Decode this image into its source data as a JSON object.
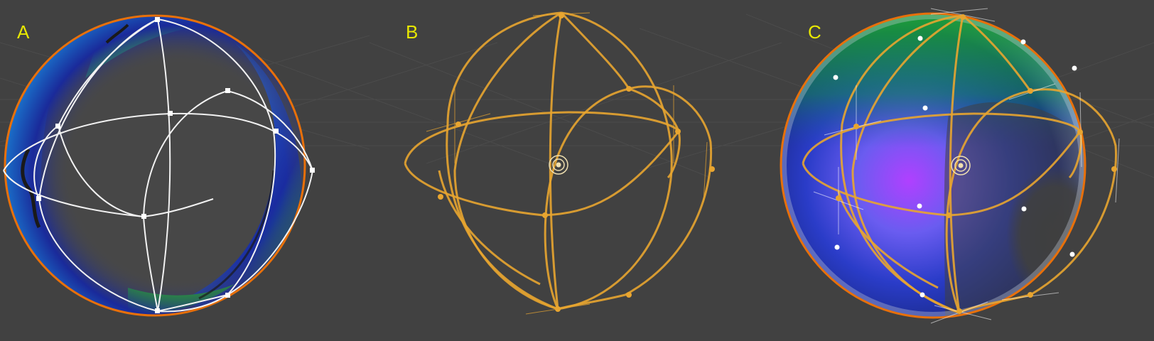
{
  "panels": [
    {
      "label": "A",
      "style": "shaded-white-cage"
    },
    {
      "label": "B",
      "style": "wireframe"
    },
    {
      "label": "C",
      "style": "shaded-orange-cage"
    }
  ],
  "colors": {
    "viewport_background": "#414141",
    "grid_line": "#4b4b4b",
    "label_text": "#e8e800",
    "selection_outline": "#e8700a",
    "cage_white": "#f2f2f2",
    "cage_orange": "#e8a530",
    "origin_marker": "#f0e0b0",
    "vertex_dot": "#ffffff"
  },
  "icons": [
    "origin-marker-icon"
  ]
}
